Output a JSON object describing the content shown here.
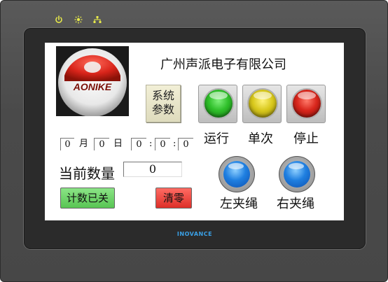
{
  "device": {
    "brand": "INOVANCE",
    "indicators": [
      {
        "icon": "power-icon"
      },
      {
        "icon": "sun-icon"
      },
      {
        "icon": "network-icon"
      }
    ]
  },
  "header": {
    "logo_text": "AONIKE",
    "company": "广州声派电子有限公司"
  },
  "system_button": {
    "line1": "系统",
    "line2": "参数"
  },
  "indicators": {
    "run": {
      "label": "运行",
      "color": "#2fbf2a"
    },
    "single": {
      "label": "单次",
      "color": "#d8c81c"
    },
    "stop": {
      "label": "停止",
      "color": "#d8261c"
    }
  },
  "datetime": {
    "month_value": "0",
    "month_unit": "月",
    "day_value": "0",
    "day_unit": "日",
    "hour": "0",
    "minute": "0",
    "second": "0",
    "separator": ":"
  },
  "counter": {
    "label": "当前数量",
    "value": "0"
  },
  "buttons": {
    "count_toggle": {
      "label": "计数已关",
      "color": "#6fd86a"
    },
    "clear": {
      "label": "清零",
      "color": "#e8403a"
    },
    "left_clamp": {
      "label": "左夹绳"
    },
    "right_clamp": {
      "label": "右夹绳"
    }
  }
}
